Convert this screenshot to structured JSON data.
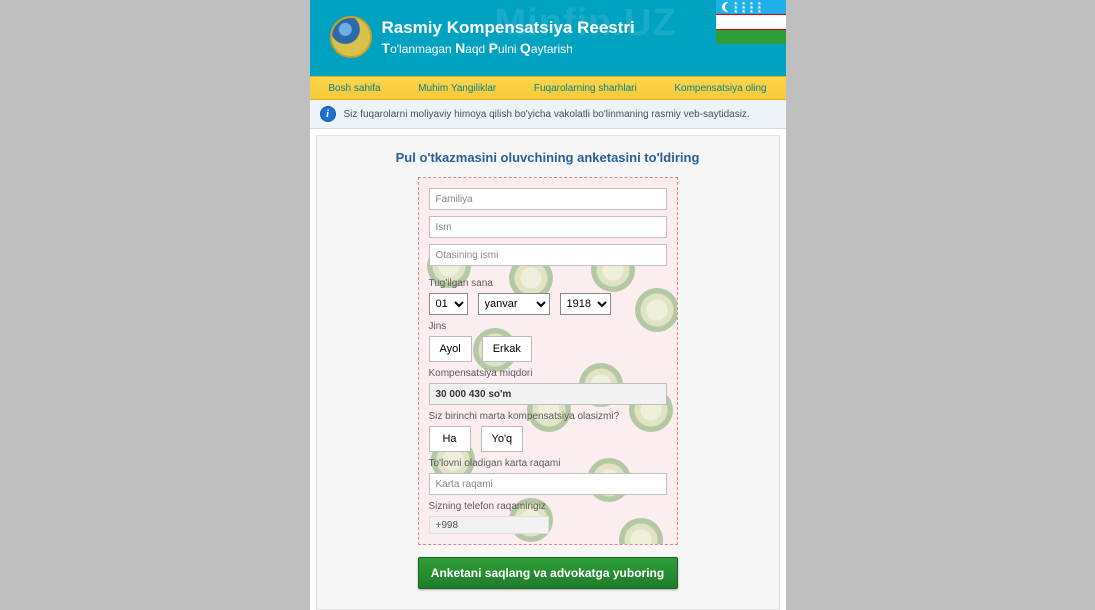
{
  "header": {
    "watermark": "Minfin.UZ",
    "title": "Rasmiy Kompensatsiya Reestri",
    "subtitle_parts": [
      "T",
      "o'lanmagan ",
      "N",
      "aqd ",
      "P",
      "ulni ",
      "Q",
      "aytarish"
    ]
  },
  "nav": {
    "items": [
      "Bosh sahifa",
      "Muhim Yangiliklar",
      "Fuqarolarning sharhlari",
      "Kompensatsiya oling"
    ]
  },
  "info": {
    "text": "Siz fuqarolarni moliyaviy himoya qilish bo'yicha vakolatli bo'linmaning rasmiy veb-saytidasiz."
  },
  "form": {
    "title": "Pul o'tkazmasini oluvchining anketasini to'ldiring",
    "surname_placeholder": "Familiya",
    "name_placeholder": "Ism",
    "patronymic_placeholder": "Otasining ismi",
    "dob": {
      "label": "Tug'ilgan sana",
      "day": "01",
      "month": "yanvar",
      "year": "1918"
    },
    "gender": {
      "label": "Jins",
      "female": "Ayol",
      "male": "Erkak"
    },
    "amount": {
      "label": "Kompensatsiya miqdori",
      "value": "30 000 430 so'm"
    },
    "first_time": {
      "label": "Siz birinchi marta kompensatsiya olasizmi?",
      "yes": "Ha",
      "no": "Yo'q"
    },
    "card": {
      "label": "To'lovni oladigan karta raqami",
      "placeholder": "Karta raqami"
    },
    "phone": {
      "label": "Sizning telefon raqamingiz",
      "value": "+998"
    },
    "submit": "Anketani saqlang va advokatga yuboring"
  }
}
